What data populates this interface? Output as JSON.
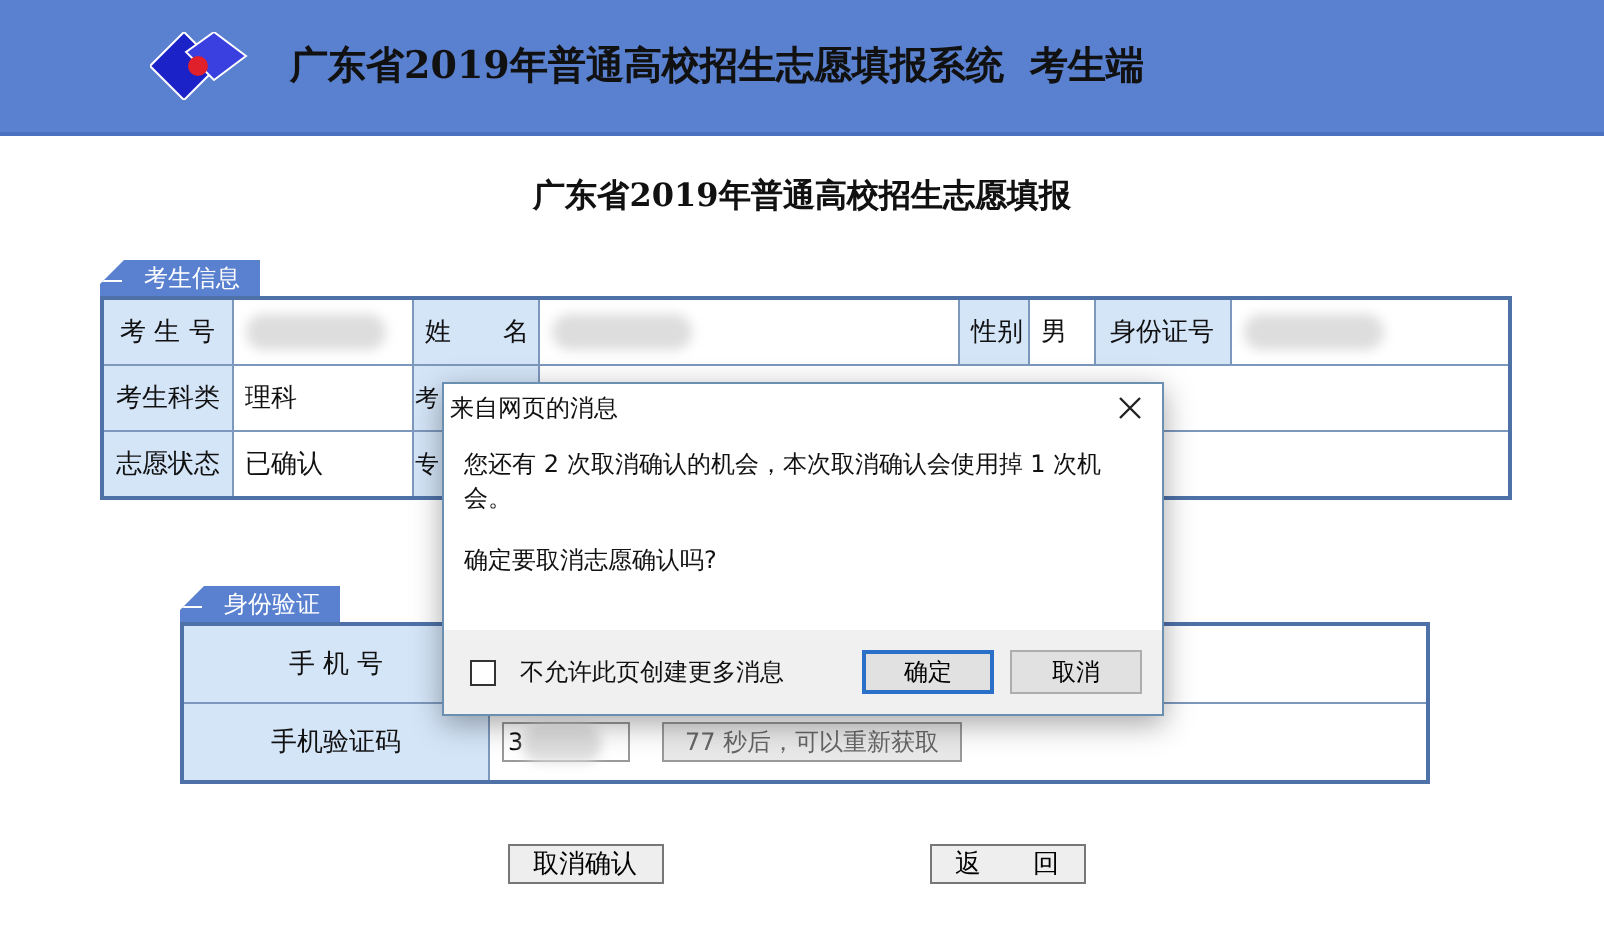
{
  "header": {
    "title": "广东省2019年普通高校招生志愿填报系统  考生端"
  },
  "page_title": "广东省2019年普通高校招生志愿填报",
  "info_section": {
    "tab": "考生信息",
    "rows": [
      [
        {
          "kind": "label",
          "text": "考 生 号"
        },
        {
          "kind": "redacted"
        },
        {
          "kind": "label",
          "text": "姓　　名"
        },
        {
          "kind": "redacted"
        },
        {
          "kind": "label",
          "text": "性别"
        },
        {
          "kind": "value",
          "text": "男"
        },
        {
          "kind": "label",
          "text": "身份证号"
        },
        {
          "kind": "redacted"
        }
      ],
      [
        {
          "kind": "label",
          "text": "考生科类"
        },
        {
          "kind": "value",
          "text": "理科"
        },
        {
          "kind": "cut_label",
          "text": "考"
        },
        {
          "kind": "value"
        }
      ],
      [
        {
          "kind": "label",
          "text": "志愿状态"
        },
        {
          "kind": "value",
          "text": "已确认"
        },
        {
          "kind": "cut_label",
          "text": "专"
        },
        {
          "kind": "value"
        }
      ]
    ]
  },
  "verify_section": {
    "tab": "身份验证",
    "rows": [
      {
        "kind": "plain",
        "label": "手 机 号"
      },
      {
        "kind": "code",
        "label": "手机验证码",
        "value": "3",
        "timer": {
          "label": "77 秒后，可以重新获取",
          "disabled": true
        }
      }
    ]
  },
  "actions": [
    {
      "label": "取消确认"
    },
    {
      "label": "返　　回"
    }
  ],
  "dialog": {
    "title": "来自网页的消息",
    "messages": [
      "您还有 2 次取消确认的机会，本次取消确认会使用掉 1 次机会。",
      "确定要取消志愿确认吗?"
    ],
    "checkbox": {
      "label": "不允许此页创建更多消息",
      "checked": false
    },
    "buttons": [
      {
        "label": "确定",
        "default": true
      },
      {
        "label": "取消",
        "default": false
      }
    ]
  }
}
